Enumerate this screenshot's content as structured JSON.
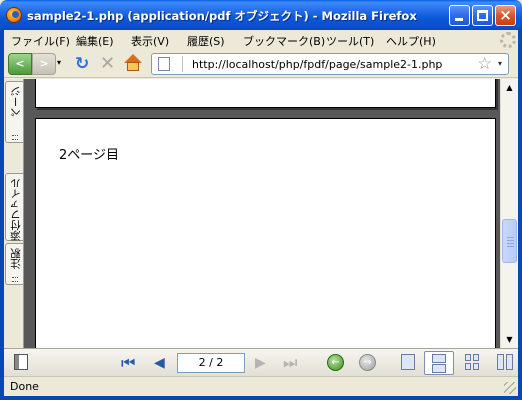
{
  "window": {
    "title": "sample2-1.php (application/pdf オブジェクト) - Mozilla Firefox",
    "controls": {
      "minimize": "minimize-icon",
      "maximize": "maximize-icon",
      "close": "×"
    }
  },
  "menu": {
    "items": [
      "ファイル(F)",
      "編集(E)",
      "表示(V)",
      "履歴(S)",
      "ブックマーク(B)",
      "ツール(T)",
      "ヘルプ(H)"
    ]
  },
  "navbar": {
    "back": "<",
    "forward": ">",
    "history_dropdown": "▾",
    "reload": "↻",
    "stop": "✕",
    "url": "http://localhost/php/fpdf/page/sample2-1.php",
    "bookmark_star": "☆",
    "url_dropdown": "▾"
  },
  "sidebar": {
    "tabs": [
      "ページ",
      "添付ファイル",
      "注釈"
    ]
  },
  "document": {
    "page_text": "2ページ目"
  },
  "pdf_toolbar": {
    "first": "⏮",
    "prev": "◀",
    "page_field": "2 / 2",
    "next": "▶",
    "last": "⏭",
    "back": "←",
    "forward": "→",
    "view_mode_selected": "continuous"
  },
  "statusbar": {
    "text": "Done"
  },
  "colors": {
    "titlebar": "#0a50cc",
    "viewer_background": "#585858",
    "chrome": "#ece9d8"
  }
}
